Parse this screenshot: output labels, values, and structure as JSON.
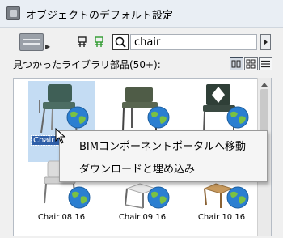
{
  "window": {
    "title": "オブジェクトのデフォルト設定"
  },
  "toolbar": {
    "search": {
      "value": "chair",
      "placeholder": ""
    }
  },
  "results": {
    "header_label": "見つかったライブラリ部品(50+):",
    "items": [
      {
        "label": "Chair 1",
        "selected": true
      },
      {
        "label": ""
      },
      {
        "label": ""
      },
      {
        "label": "Chair 08 16"
      },
      {
        "label": "Chair 09 16"
      },
      {
        "label": "Chair 10 16"
      }
    ]
  },
  "context_menu": {
    "items": [
      {
        "label": "BIMコンポーネントポータルへ移動"
      },
      {
        "label": "ダウンロードと埋め込み"
      }
    ]
  },
  "colors": {
    "selection_bg": "#c4dcf3",
    "label_highlight": "#2f5fa8",
    "globe_blue": "#2b7fd1",
    "globe_green": "#7ac142"
  },
  "icons": [
    "app-icon",
    "view-mode-icon",
    "library-tree-icon",
    "library-tree-green-icon",
    "search-icon",
    "arrow-right-icon",
    "large-thumbnail-icon",
    "small-thumbnail-icon",
    "list-view-icon",
    "globe-icon",
    "mouse-cursor-icon"
  ]
}
